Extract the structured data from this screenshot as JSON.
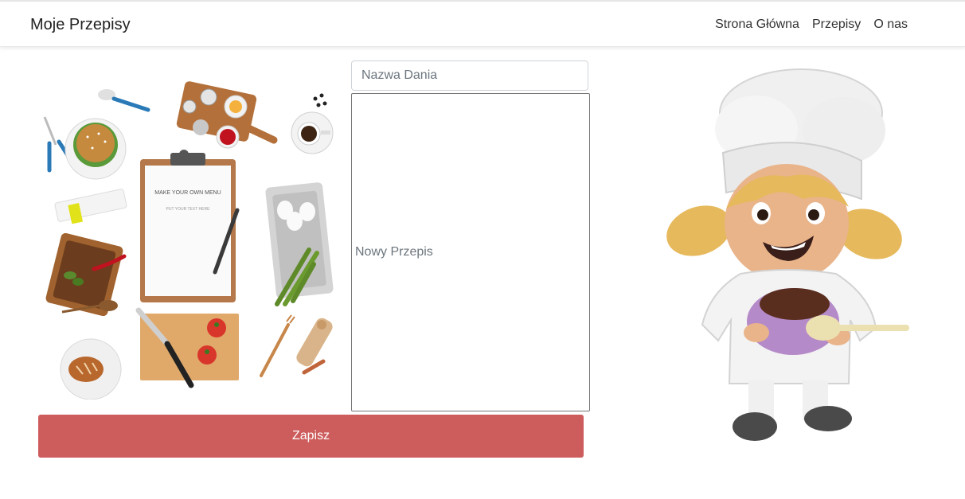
{
  "navbar": {
    "brand": "Moje Przepisy",
    "links": [
      "Strona Główna",
      "Przepisy",
      "O nas"
    ]
  },
  "form": {
    "title_placeholder": "Nazwa Dania",
    "recipe_placeholder": "Nowy Przepis",
    "save_label": "Zapisz",
    "save_color": "#cd5c5c"
  },
  "collage": {
    "menu_heading": "MAKE YOUR OWN MENU",
    "menu_sub": "PUT YOUR TEXT HERE"
  }
}
